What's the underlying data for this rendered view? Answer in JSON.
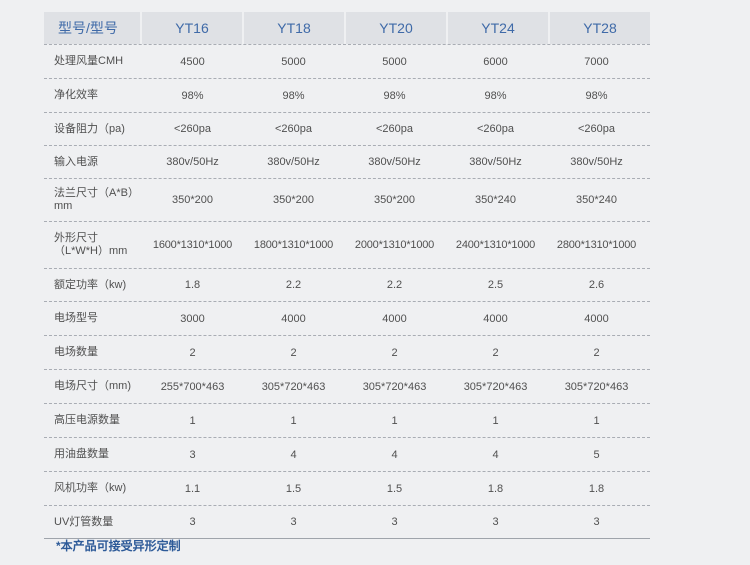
{
  "header": {
    "label": "型号/型号",
    "models": [
      "YT16",
      "YT18",
      "YT20",
      "YT24",
      "YT28"
    ]
  },
  "rows": [
    {
      "label": "处理风量CMH",
      "values": [
        "4500",
        "5000",
        "5000",
        "6000",
        "7000"
      ]
    },
    {
      "label": "净化效率",
      "values": [
        "98%",
        "98%",
        "98%",
        "98%",
        "98%"
      ]
    },
    {
      "label": "设备阻力（pa)",
      "values": [
        "<260pa",
        "<260pa",
        "<260pa",
        "<260pa",
        "<260pa"
      ]
    },
    {
      "label": "输入电源",
      "values": [
        "380v/50Hz",
        "380v/50Hz",
        "380v/50Hz",
        "380v/50Hz",
        "380v/50Hz"
      ]
    },
    {
      "label": "法兰尺寸（A*B）mm",
      "values": [
        "350*200",
        "350*200",
        "350*200",
        "350*240",
        "350*240"
      ]
    },
    {
      "label": "外形尺寸（L*W*H）mm",
      "values": [
        "1600*1310*1000",
        "1800*1310*1000",
        "2000*1310*1000",
        "2400*1310*1000",
        "2800*1310*1000"
      ]
    },
    {
      "label": "额定功率（kw)",
      "values": [
        "1.8",
        "2.2",
        "2.2",
        "2.5",
        "2.6"
      ]
    },
    {
      "label": "电场型号",
      "values": [
        "3000",
        "4000",
        "4000",
        "4000",
        "4000"
      ]
    },
    {
      "label": "电场数量",
      "values": [
        "2",
        "2",
        "2",
        "2",
        "2"
      ]
    },
    {
      "label": "电场尺寸（mm)",
      "values": [
        "255*700*463",
        "305*720*463",
        "305*720*463",
        "305*720*463",
        "305*720*463"
      ]
    },
    {
      "label": "高压电源数量",
      "values": [
        "1",
        "1",
        "1",
        "1",
        "1"
      ]
    },
    {
      "label": "用油盘数量",
      "values": [
        "3",
        "4",
        "4",
        "4",
        "5"
      ]
    },
    {
      "label": "风机功率（kw)",
      "values": [
        "1.1",
        "1.5",
        "1.5",
        "1.8",
        "1.8"
      ]
    },
    {
      "label": "UV灯管数量",
      "values": [
        "3",
        "3",
        "3",
        "3",
        "3"
      ]
    }
  ],
  "footnote": "*本产品可接受异形定制"
}
